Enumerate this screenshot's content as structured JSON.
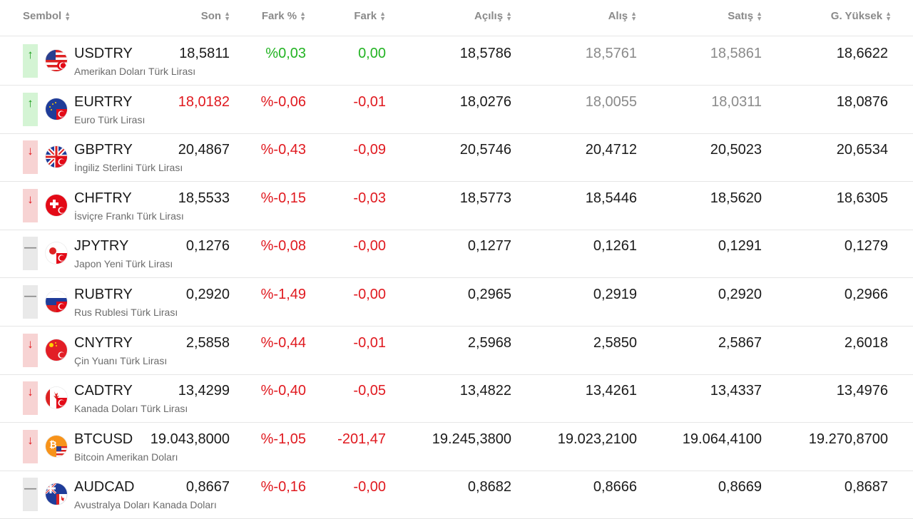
{
  "header": {
    "sembol": "Sembol",
    "son": "Son",
    "fark_yuzde": "Fark %",
    "fark": "Fark",
    "acilis": "Açılış",
    "alis": "Alış",
    "satis": "Satış",
    "g_yuksek": "G. Yüksek"
  },
  "colors": {
    "up": "#22b322",
    "down": "#e0191f",
    "muted": "#8a8a8a"
  },
  "rows": [
    {
      "trend": "up",
      "arrow": "↑",
      "flag": "us-flag-icon",
      "symbol": "USDTRY",
      "name": "Amerikan Doları Türk Lirası",
      "son": "18,5811",
      "son_color": "",
      "fark_yuzde": "%0,03",
      "fark": "0,00",
      "acilis": "18,5786",
      "alis": "18,5761",
      "satis": "18,5861",
      "g_yuksek": "18,6622",
      "muted": true
    },
    {
      "trend": "up",
      "arrow": "↑",
      "flag": "eu-flag-icon",
      "symbol": "EURTRY",
      "name": "Euro Türk Lirası",
      "son": "18,0182",
      "son_color": "red",
      "fark_yuzde": "%-0,06",
      "fark": "-0,01",
      "acilis": "18,0276",
      "alis": "18,0055",
      "satis": "18,0311",
      "g_yuksek": "18,0876",
      "muted": true
    },
    {
      "trend": "down",
      "arrow": "↓",
      "flag": "gb-flag-icon",
      "symbol": "GBPTRY",
      "name": "İngiliz Sterlini Türk Lirası",
      "son": "20,4867",
      "son_color": "",
      "fark_yuzde": "%-0,43",
      "fark": "-0,09",
      "acilis": "20,5746",
      "alis": "20,4712",
      "satis": "20,5023",
      "g_yuksek": "20,6534",
      "muted": false
    },
    {
      "trend": "down",
      "arrow": "↓",
      "flag": "ch-flag-icon",
      "symbol": "CHFTRY",
      "name": "İsviçre Frankı Türk Lirası",
      "son": "18,5533",
      "son_color": "",
      "fark_yuzde": "%-0,15",
      "fark": "-0,03",
      "acilis": "18,5773",
      "alis": "18,5446",
      "satis": "18,5620",
      "g_yuksek": "18,6305",
      "muted": false
    },
    {
      "trend": "flat",
      "arrow": "—",
      "flag": "jp-flag-icon",
      "symbol": "JPYTRY",
      "name": "Japon Yeni Türk Lirası",
      "son": "0,1276",
      "son_color": "",
      "fark_yuzde": "%-0,08",
      "fark": "-0,00",
      "acilis": "0,1277",
      "alis": "0,1261",
      "satis": "0,1291",
      "g_yuksek": "0,1279",
      "muted": false
    },
    {
      "trend": "flat",
      "arrow": "—",
      "flag": "ru-flag-icon",
      "symbol": "RUBTRY",
      "name": "Rus Rublesi Türk Lirası",
      "son": "0,2920",
      "son_color": "",
      "fark_yuzde": "%-1,49",
      "fark": "-0,00",
      "acilis": "0,2965",
      "alis": "0,2919",
      "satis": "0,2920",
      "g_yuksek": "0,2966",
      "muted": false
    },
    {
      "trend": "down",
      "arrow": "↓",
      "flag": "cn-flag-icon",
      "symbol": "CNYTRY",
      "name": "Çin Yuanı Türk Lirası",
      "son": "2,5858",
      "son_color": "",
      "fark_yuzde": "%-0,44",
      "fark": "-0,01",
      "acilis": "2,5968",
      "alis": "2,5850",
      "satis": "2,5867",
      "g_yuksek": "2,6018",
      "muted": false
    },
    {
      "trend": "down",
      "arrow": "↓",
      "flag": "ca-flag-icon",
      "symbol": "CADTRY",
      "name": "Kanada Doları Türk Lirası",
      "son": "13,4299",
      "son_color": "",
      "fark_yuzde": "%-0,40",
      "fark": "-0,05",
      "acilis": "13,4822",
      "alis": "13,4261",
      "satis": "13,4337",
      "g_yuksek": "13,4976",
      "muted": false
    },
    {
      "trend": "down",
      "arrow": "↓",
      "flag": "btc-flag-icon",
      "symbol": "BTCUSD",
      "name": "Bitcoin Amerikan Doları",
      "son": "19.043,8000",
      "son_color": "",
      "fark_yuzde": "%-1,05",
      "fark": "-201,47",
      "acilis": "19.245,3800",
      "alis": "19.023,2100",
      "satis": "19.064,4100",
      "g_yuksek": "19.270,8700",
      "muted": false
    },
    {
      "trend": "flat",
      "arrow": "—",
      "flag": "au-flag-icon",
      "symbol": "AUDCAD",
      "name": "Avustralya Doları Kanada Doları",
      "son": "0,8667",
      "son_color": "",
      "fark_yuzde": "%-0,16",
      "fark": "-0,00",
      "acilis": "0,8682",
      "alis": "0,8666",
      "satis": "0,8669",
      "g_yuksek": "0,8687",
      "muted": false
    }
  ]
}
